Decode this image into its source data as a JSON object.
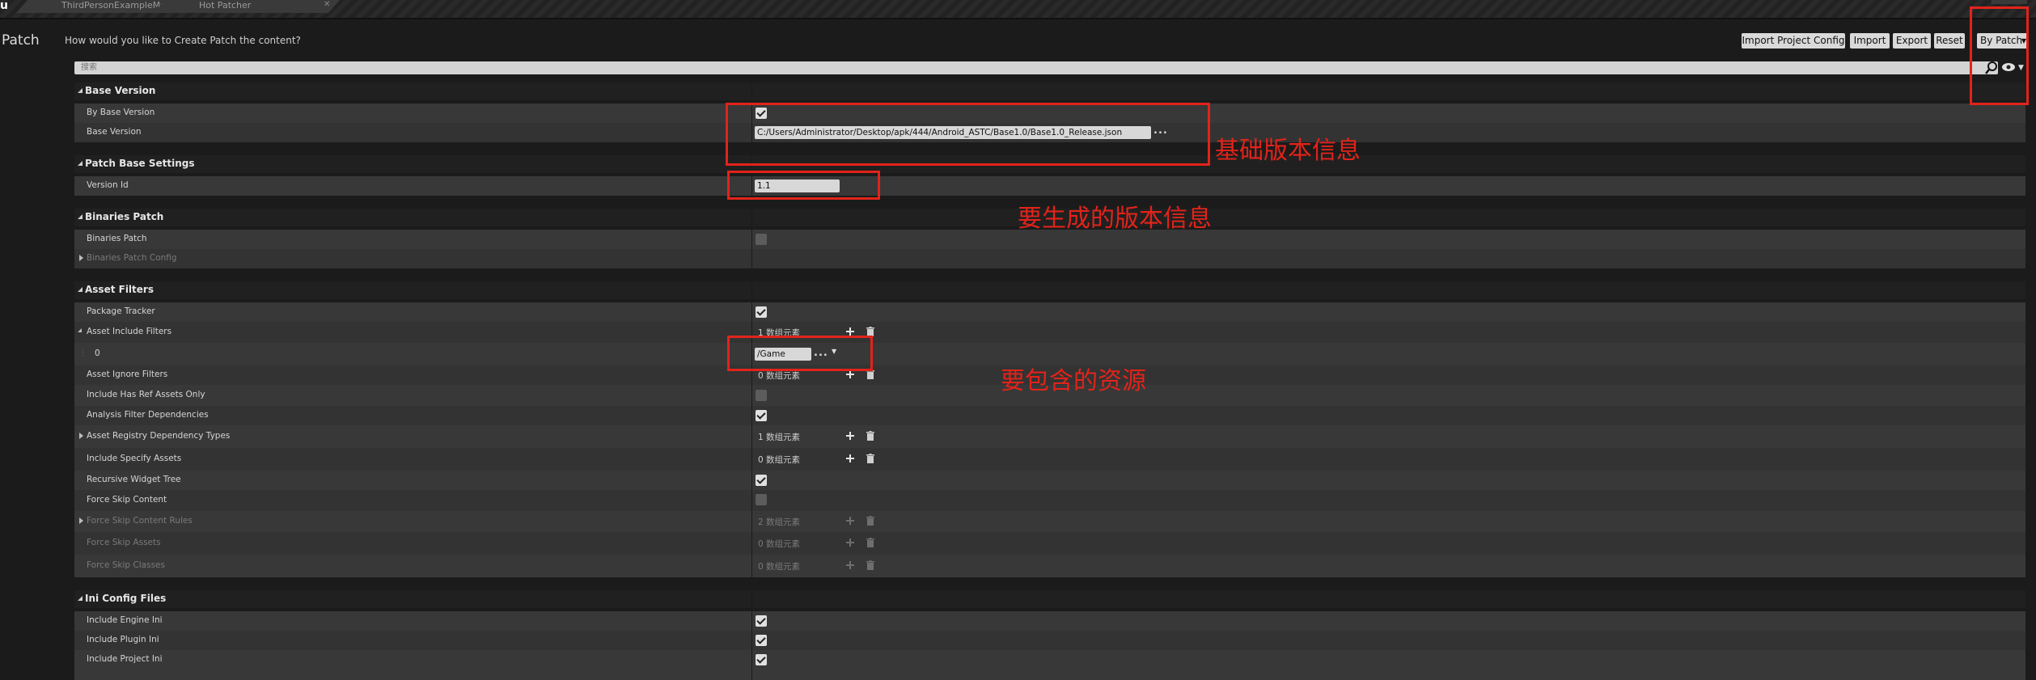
{
  "tabs": [
    {
      "label": "ThirdPersonExampleMap"
    },
    {
      "label": "Hot Patcher"
    }
  ],
  "header": {
    "title": "Patch",
    "question": "How would you like to Create Patch the content?",
    "buttons": {
      "import_project_config": "Import Project Config",
      "import": "Import",
      "export": "Export",
      "reset": "Reset",
      "mode": "By Patch"
    }
  },
  "search": {
    "placeholder": "搜索"
  },
  "sections": {
    "base_version": {
      "title": "Base Version",
      "by_base_version": {
        "label": "By Base Version",
        "checked": true
      },
      "base_version": {
        "label": "Base Version",
        "value": "C:/Users/Administrator/Desktop/apk/444/Android_ASTC/Base1.0/Base1.0_Release.json"
      }
    },
    "patch_base_settings": {
      "title": "Patch Base Settings",
      "version_id": {
        "label": "Version Id",
        "value": "1.1"
      }
    },
    "binaries_patch": {
      "title": "Binaries Patch",
      "binaries_patch": {
        "label": "Binaries Patch",
        "checked": false
      },
      "binaries_patch_config": {
        "label": "Binaries Patch Config"
      }
    },
    "asset_filters": {
      "title": "Asset Filters",
      "package_tracker": {
        "label": "Package Tracker",
        "checked": true
      },
      "asset_include_filters": {
        "label": "Asset Include Filters",
        "count": "1 数组元素"
      },
      "include_item": {
        "index": "0",
        "value": "/Game"
      },
      "asset_ignore_filters": {
        "label": "Asset Ignore Filters",
        "count": "0 数组元素"
      },
      "include_has_ref_assets_only": {
        "label": "Include Has Ref Assets Only",
        "checked": false
      },
      "analysis_filter_dependencies": {
        "label": "Analysis Filter Dependencies",
        "checked": true
      },
      "asset_registry_dependency_types": {
        "label": "Asset Registry Dependency Types",
        "count": "1 数组元素"
      },
      "include_specify_assets": {
        "label": "Include Specify Assets",
        "count": "0 数组元素"
      },
      "recursive_widget_tree": {
        "label": "Recursive Widget Tree",
        "checked": true
      },
      "force_skip_content": {
        "label": "Force Skip Content",
        "checked": false
      },
      "force_skip_content_rules": {
        "label": "Force Skip Content Rules",
        "count": "2 数组元素"
      },
      "force_skip_assets": {
        "label": "Force Skip Assets",
        "count": "0 数组元素"
      },
      "force_skip_classes": {
        "label": "Force Skip Classes",
        "count": "0 数组元素"
      }
    },
    "ini_config_files": {
      "title": "Ini Config Files",
      "include_engine_ini": {
        "label": "Include Engine Ini",
        "checked": true
      },
      "include_plugin_ini": {
        "label": "Include Plugin Ini",
        "checked": true
      },
      "include_project_ini": {
        "label": "Include Project Ini",
        "checked": true
      }
    }
  },
  "annotations": {
    "base_info": "基础版本信息",
    "version_info": "要生成的版本信息",
    "assets_info": "要包含的资源"
  },
  "colors": {
    "annotation_red": "#e2231a",
    "panel_bg": "#383838",
    "window_bg": "#1b1b1b"
  }
}
